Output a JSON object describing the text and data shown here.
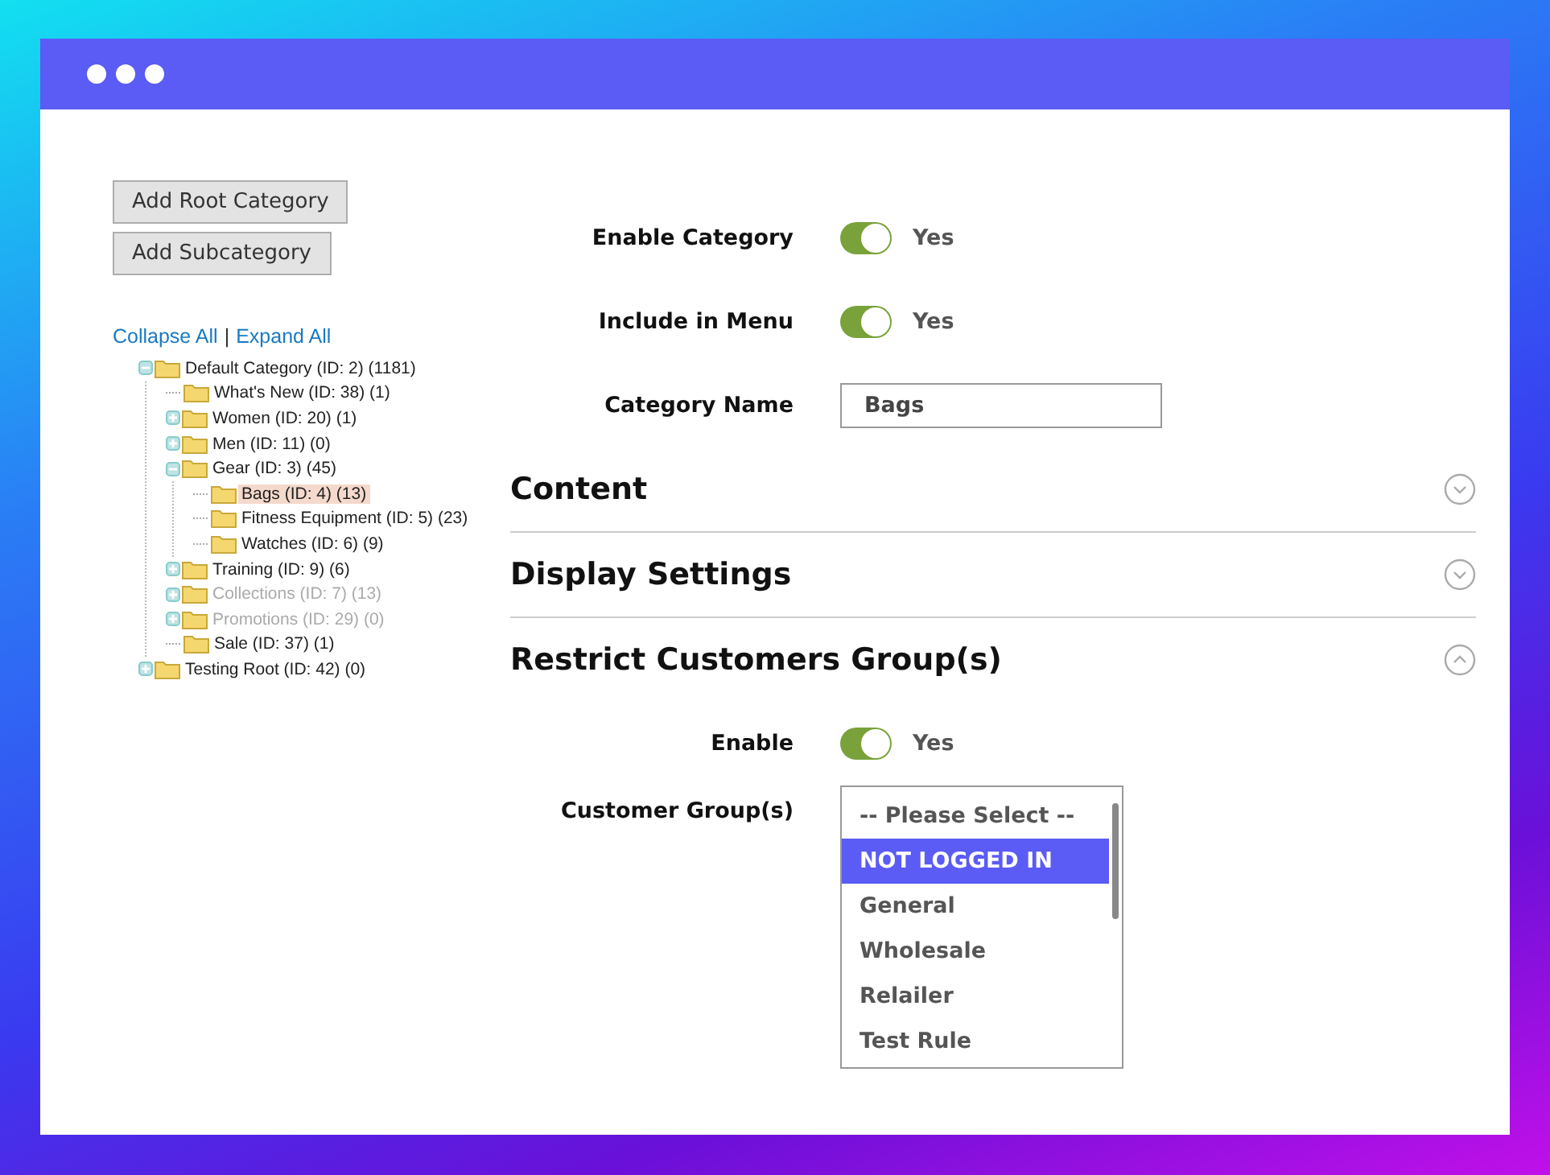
{
  "buttons": [
    "Add Root Category",
    "Add Subcategory"
  ],
  "tree_links": [
    "Collapse All",
    "Expand All"
  ],
  "tree_separator": "|",
  "tree": [
    {
      "label": "Default Category (ID: 2) (1181)",
      "kind": "branch",
      "expanded": true,
      "selected": false,
      "disabled": false,
      "children": [
        {
          "label": "What's New (ID: 38) (1)",
          "kind": "leaf",
          "selected": false,
          "disabled": false
        },
        {
          "label": "Women (ID: 20) (1)",
          "kind": "branch",
          "expanded": false,
          "selected": false,
          "disabled": false
        },
        {
          "label": "Men (ID: 11) (0)",
          "kind": "branch",
          "expanded": false,
          "selected": false,
          "disabled": false
        },
        {
          "label": "Gear (ID: 3) (45)",
          "kind": "branch",
          "expanded": true,
          "selected": false,
          "disabled": false,
          "children": [
            {
              "label": "Bags (ID: 4) (13)",
              "kind": "leaf",
              "selected": true,
              "disabled": false
            },
            {
              "label": "Fitness Equipment (ID: 5) (23)",
              "kind": "leaf",
              "selected": false,
              "disabled": false
            },
            {
              "label": "Watches (ID: 6) (9)",
              "kind": "leaf",
              "selected": false,
              "disabled": false
            }
          ]
        },
        {
          "label": "Training (ID: 9) (6)",
          "kind": "branch",
          "expanded": false,
          "selected": false,
          "disabled": false
        },
        {
          "label": "Collections (ID: 7) (13)",
          "kind": "branch",
          "expanded": false,
          "selected": false,
          "disabled": true
        },
        {
          "label": "Promotions (ID: 29) (0)",
          "kind": "branch",
          "expanded": false,
          "selected": false,
          "disabled": true
        },
        {
          "label": "Sale (ID: 37) (1)",
          "kind": "leaf",
          "selected": false,
          "disabled": false
        }
      ]
    },
    {
      "label": "Testing Root (ID: 42) (0)",
      "kind": "branch",
      "expanded": false,
      "selected": false,
      "disabled": false
    }
  ],
  "fields": [
    {
      "kind": "toggle",
      "label": "Enable Category",
      "on": true,
      "value": "Yes"
    },
    {
      "kind": "toggle",
      "label": "Include in Menu",
      "on": true,
      "value": "Yes"
    },
    {
      "kind": "text",
      "label": "Category Name",
      "value": "Bags"
    }
  ],
  "sections": [
    {
      "title": "Content",
      "expanded": false
    },
    {
      "title": "Display Settings",
      "expanded": false
    },
    {
      "title": "Restrict Customers Group(s)",
      "expanded": true,
      "fields": [
        {
          "kind": "toggle",
          "label": "Enable",
          "on": true,
          "value": "Yes"
        },
        {
          "kind": "multiselect",
          "label": "Customer Group(s)",
          "options": [
            {
              "label": "-- Please Select --",
              "selected": false
            },
            {
              "label": "NOT LOGGED IN",
              "selected": true
            },
            {
              "label": "General",
              "selected": false
            },
            {
              "label": "Wholesale",
              "selected": false
            },
            {
              "label": "Relailer",
              "selected": false
            },
            {
              "label": "Test Rule",
              "selected": false
            }
          ]
        }
      ]
    }
  ]
}
